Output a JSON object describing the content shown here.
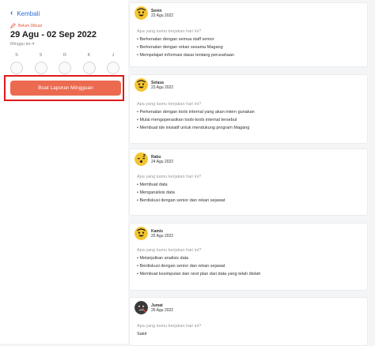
{
  "back_label": "Kembali",
  "status_label": "Belum Dibuat",
  "period": "29 Agu - 02 Sep 2022",
  "week_label": "Minggu ke-4",
  "days": [
    "S",
    "S",
    "R",
    "K",
    "J"
  ],
  "report_button": "Buat Laporan Mingguan",
  "question": "Apa yang kamu kerjakan hari ini?",
  "colors": {
    "accent": "#ec6a50",
    "link": "#2f6fd6",
    "highlight": "#e01818",
    "mood_happy": "#f4c430"
  },
  "entries": [
    {
      "day": "Senin",
      "date": "22 Agu 2022",
      "mood": "happy-face-icon",
      "items": [
        "• Berkenalan dengan semua staff senior",
        "• Berkenalan dengan rekan sesama Magang",
        "• Mempelajari informasi dasar tentang perusahaan"
      ]
    },
    {
      "day": "Selasa",
      "date": "23 Agu 2022",
      "mood": "happy-face-icon",
      "items": [
        "• Perkenalan dengan tools internal yang akan intern gunakan",
        "• Mulai mengoperasikan tools-tools internal tersebut",
        "• Membuat ide inisiatif untuk mendukung program Magang"
      ]
    },
    {
      "day": "Rabu",
      "date": "24 Agu 2022",
      "mood": "tired-face-icon",
      "items": [
        "• Membuat data",
        "• Menganalisis data",
        "• Berdiskusi dengan senior dan rekan sejawat"
      ]
    },
    {
      "day": "Kamis",
      "date": "25 Agu 2022",
      "mood": "happy-face-icon",
      "items": [
        "• Melanjutkan analisis data",
        "• Berdiskusi dengan senior dan rekan sejawat",
        "• Membuat kesimpulan dan next plan dari data yang telah diolah"
      ]
    },
    {
      "day": "Jumat",
      "date": "26 Agu 2022",
      "mood": "sick-face-icon",
      "items": [
        "Sakit"
      ]
    }
  ]
}
